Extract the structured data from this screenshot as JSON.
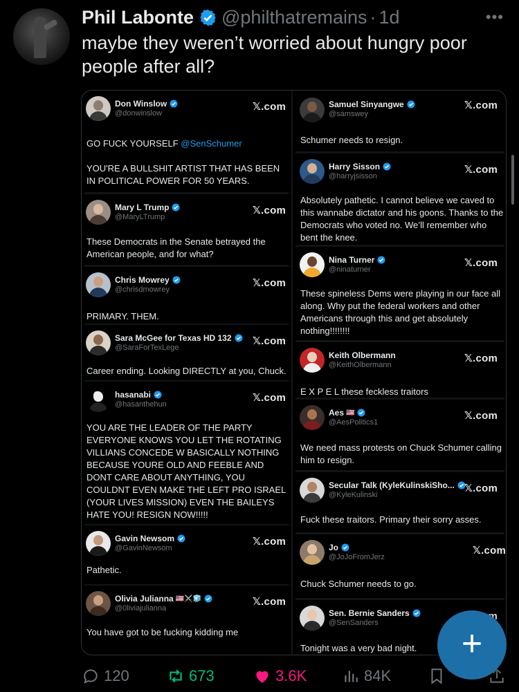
{
  "post": {
    "author_name": "Phil Labonte",
    "author_handle": "@philthatremains",
    "separator": "·",
    "age": "1d",
    "more": "•••",
    "text": "maybe they weren’t worried about hungry poor people after all?"
  },
  "brand_label": "𝕏.com",
  "left_cards": [
    {
      "name": "Don Winslow",
      "handle": "@donwinslow",
      "text_a": "GO FUCK YOURSELF ",
      "mention": "@SenSchumer",
      "text_b": "YOU'RE A BULLSHIT ARTIST THAT HAS BEEN IN POLITICAL POWER FOR 50 YEARS."
    },
    {
      "name": "Mary L Trump",
      "handle": "@MaryLTrump",
      "text": "These Democrats in the Senate betrayed the American people, and for what?"
    },
    {
      "name": "Chris Mowrey",
      "handle": "@chrisdmowrey",
      "text": "PRIMARY. THEM."
    },
    {
      "name": "Sara McGee for Texas HD 132",
      "handle": "@SaraForTexLege",
      "text": "Career ending. Looking DIRECTLY at you, Chuck."
    },
    {
      "name": "hasanabi",
      "handle": "@hasanthehun",
      "text": "YOU ARE THE LEADER OF THE PARTY EVERYONE KNOWS YOU LET THE ROTATING VILLIANS CONCEDE W BASICALLY NOTHING BECAUSE YOURE OLD AND FEEBLE AND DONT CARE ABOUT ANYTHING, YOU COULDNT EVEN MAKE THE LEFT PRO ISRAEL (YOUR LIVES MISSION) EVEN THE BAILEYS HATE YOU! RESIGN NOW!!!!!"
    },
    {
      "name": "Gavin Newsom",
      "handle": "@GavinNewsom",
      "text": "Pathetic."
    },
    {
      "name": "Olivia Julianna",
      "emoji": "🇺🇸⚔️🧊",
      "handle": "@0liviajulianna",
      "text": "You have got to be fucking kidding me"
    }
  ],
  "right_cards": [
    {
      "name": "Samuel Sinyangwe",
      "handle": "@samswey",
      "text": "Schumer needs to resign."
    },
    {
      "name": "Harry Sisson",
      "handle": "@harryjsisson",
      "text": "Absolutely pathetic. I cannot believe we caved to this wannabe dictator and his goons. Thanks to the Democrats who voted no. We’ll remember who bent the knee."
    },
    {
      "name": "Nina Turner",
      "handle": "@ninaturner",
      "text": "These spineless Dems were playing in our face all along. Why put the federal workers and other Americans through this and get absolutely nothing!!!!!!!!"
    },
    {
      "name": "Keith Olbermann",
      "handle": "@KeithOlbermann",
      "text": "E X P E L these feckless traitors"
    },
    {
      "name": "Aes",
      "emoji": "🇺🇸",
      "handle": "@AesPolitics1",
      "text": "We need mass protests on Chuck Schumer calling him to resign."
    },
    {
      "name": "Secular Talk (KyleKulinskiSho...",
      "handle": "@KyleKulinski",
      "text": "Fuck these traitors. Primary their sorry asses."
    },
    {
      "name": "Jo",
      "handle": "@JoJoFromJerz",
      "text": "Chuck Schumer needs to go."
    },
    {
      "name": "Sen. Bernie Sanders",
      "handle": "@SenSanders",
      "text": "Tonight was a very bad night."
    }
  ],
  "actions": {
    "replies": "120",
    "reposts": "673",
    "likes": "3.6K",
    "views": "84K"
  },
  "fab_label": "+",
  "colors": {
    "accent": "#1d9bf0",
    "repost": "#00ba7c",
    "like": "#f91880",
    "muted": "#71767b"
  }
}
